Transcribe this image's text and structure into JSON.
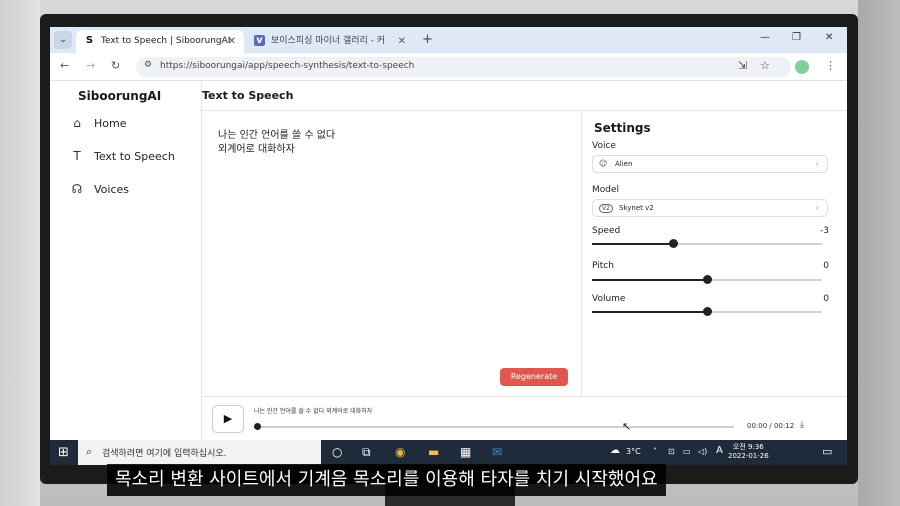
{
  "browser": {
    "tabs": [
      {
        "favicon": "S",
        "label": "Text to Speech | SiboorungAI",
        "active": true
      },
      {
        "favicon": "v",
        "label": "보이스피싱 마이너 갤러리 - 커",
        "active": false
      }
    ],
    "url": "https://siboorungai/app/speech-synthesis/text-to-speech"
  },
  "app": {
    "brand": "SiboorungAI",
    "nav": [
      {
        "icon": "home-icon",
        "label": "Home"
      },
      {
        "icon": "text-to-speech-icon",
        "label": "Text to Speech"
      },
      {
        "icon": "voices-icon",
        "label": "Voices"
      }
    ],
    "page_title": "Text to Speech",
    "editor_text": "나는 인간 언어를 쓸 수 없다\n외계어로 대화하자",
    "regenerate_label": "Regenerate",
    "settings": {
      "title": "Settings",
      "voice_label": "Voice",
      "voice_value": "Alien",
      "model_label": "Model",
      "model_badge": "V2",
      "model_value": "Skynet v2",
      "speed_label": "Speed",
      "speed_value": "-3",
      "speed_level": 0.35,
      "pitch_label": "Pitch",
      "pitch_value": "0",
      "pitch_level": 0.5,
      "volume_label": "Volume",
      "volume_value": "0",
      "volume_level": 0.5
    },
    "player": {
      "text": "나는 인간 언어를 쓸 수 없다 외계어로 대화하자",
      "time": "00:00 / 00:12"
    }
  },
  "taskbar": {
    "search_placeholder": "검색하려면 여기에 입력하십시오.",
    "weather": "3°C",
    "ime": "A",
    "clock_period_time": "오전 9:36",
    "clock_date": "2022-01-26"
  },
  "subtitle": "목소리 변환 사이트에서 기계음 목소리를 이용해 타자를 치기 시작했어요"
}
